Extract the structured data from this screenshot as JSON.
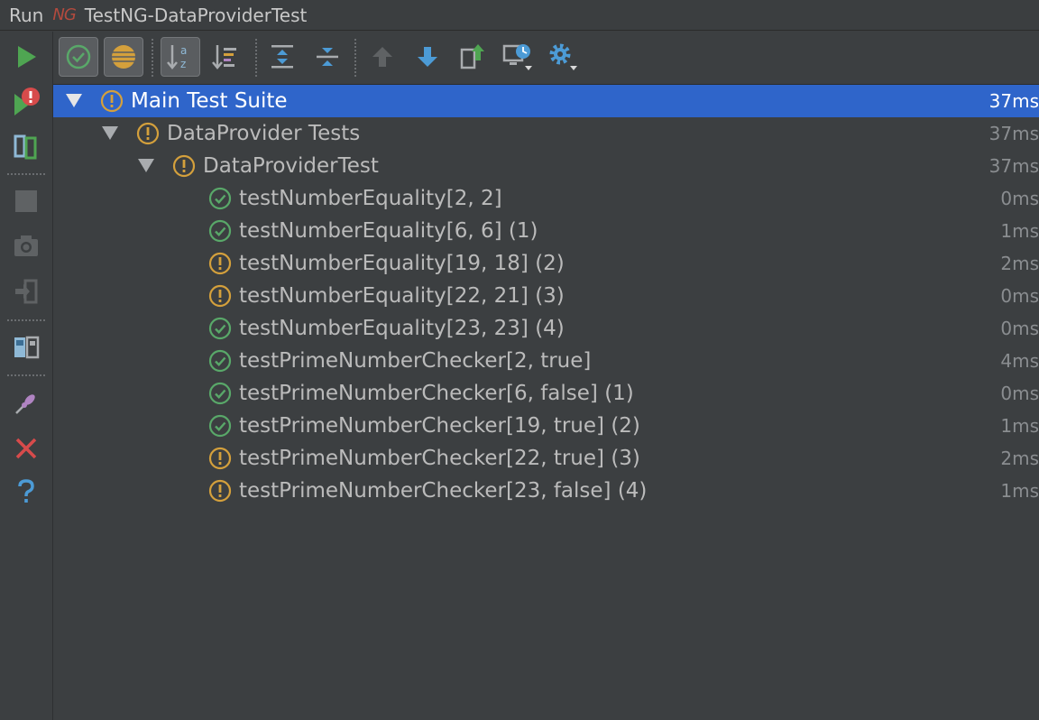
{
  "window": {
    "run_label": "Run",
    "ng_logo": "NG",
    "title": "TestNG-DataProviderTest"
  },
  "colors": {
    "pass": "#59a869",
    "warn": "#d4a03c",
    "selected": "#2f65ca"
  },
  "left_toolbar": [
    {
      "name": "rerun-icon"
    },
    {
      "name": "rerun-failed-icon"
    },
    {
      "name": "toggle-auto-test-icon"
    },
    {
      "name": "stop-icon"
    },
    {
      "name": "dump-threads-icon"
    },
    {
      "name": "exit-icon"
    },
    {
      "name": "layout-icon"
    },
    {
      "name": "pin-icon"
    },
    {
      "name": "close-icon"
    },
    {
      "name": "help-icon"
    }
  ],
  "tree": [
    {
      "label": "Main Test Suite",
      "duration": "37ms",
      "status": "warn",
      "level": 0,
      "expandable": true,
      "selected": true
    },
    {
      "label": "DataProvider Tests",
      "duration": "37ms",
      "status": "warn",
      "level": 1,
      "expandable": true
    },
    {
      "label": "DataProviderTest",
      "duration": "37ms",
      "status": "warn",
      "level": 2,
      "expandable": true
    },
    {
      "label": "testNumberEquality[2, 2]",
      "duration": "0ms",
      "status": "pass",
      "level": 3
    },
    {
      "label": "testNumberEquality[6, 6] (1)",
      "duration": "1ms",
      "status": "pass",
      "level": 3
    },
    {
      "label": "testNumberEquality[19, 18] (2)",
      "duration": "2ms",
      "status": "warn",
      "level": 3
    },
    {
      "label": "testNumberEquality[22, 21] (3)",
      "duration": "0ms",
      "status": "warn",
      "level": 3
    },
    {
      "label": "testNumberEquality[23, 23] (4)",
      "duration": "0ms",
      "status": "pass",
      "level": 3
    },
    {
      "label": "testPrimeNumberChecker[2, true]",
      "duration": "4ms",
      "status": "pass",
      "level": 3
    },
    {
      "label": "testPrimeNumberChecker[6, false] (1)",
      "duration": "0ms",
      "status": "pass",
      "level": 3
    },
    {
      "label": "testPrimeNumberChecker[19, true] (2)",
      "duration": "1ms",
      "status": "pass",
      "level": 3
    },
    {
      "label": "testPrimeNumberChecker[22, true] (3)",
      "duration": "2ms",
      "status": "warn",
      "level": 3
    },
    {
      "label": "testPrimeNumberChecker[23, false] (4)",
      "duration": "1ms",
      "status": "warn",
      "level": 3
    }
  ]
}
